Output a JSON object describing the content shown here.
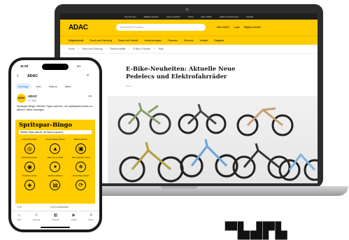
{
  "laptop": {
    "topbar": [
      "Top Themen",
      "Mitglied werden",
      "Auto & Verkehr",
      "Reise",
      "Mein ADAC",
      "ADAC Versicherung",
      "Kontakt"
    ],
    "logo": "ADAC",
    "search_placeholder": "Suchbegriff eingeben",
    "header_links": [
      "Mein ADAC",
      "Login",
      "Mitglied werden"
    ],
    "nav": [
      "Mitgliedschaft",
      "Rund ums Fahrzeug",
      "Reise und Freizeit",
      "Versicherungen",
      "Finanzen",
      "Services",
      "Vorteile",
      "Ratgeber"
    ],
    "breadcrumb": [
      "Home",
      "Rund ums Fahrzeug",
      "Elektromobilität",
      "E-Bike & Pedelec",
      "Tests"
    ],
    "article_title": "E-Bike-Neuheiten: Aktuelle Neue Pedelecs und Elektrofahrräder",
    "byline": "ADAC"
  },
  "phone": {
    "time": "11:02",
    "status": "5G",
    "page_title": "ADAC",
    "tabs": [
      "Beiträge",
      "Info",
      "Videos",
      "Mehr"
    ],
    "post_author": "ADAC",
    "post_meta": "21. Mai",
    "post_text": "Spritspar-Bingo: Welche Tipps nutzt ihr, um spritsparend Auto zu fahren? Mehr anzeigen",
    "bingo_title": "Spritspar-Bingo",
    "bingo_sub": "Welche Tipps nutzt ihr, um Sprit zu sparen?",
    "bingo_cells": [
      {
        "label": "Früh hochschalten",
        "icon": "◎"
      },
      {
        "label": "Vorausschauend fahren",
        "icon": "▲"
      },
      {
        "label": "Ballast entfernen",
        "icon": "▣"
      },
      {
        "label": "Reifendruck prüfen",
        "icon": "◉"
      },
      {
        "label": "Motor aus im Stand",
        "icon": "✦"
      },
      {
        "label": "Klima sparsam nutzen",
        "icon": "❄"
      },
      {
        "label": "Tempomat nutzen",
        "icon": "◈"
      },
      {
        "label": "Dachbox abbauen",
        "icon": "▤"
      },
      {
        "label": "Kurze Wege meiden",
        "icon": "⟳"
      }
    ],
    "reactions": "2,1K",
    "comments": "143 Kommentare",
    "bottom_nav": [
      {
        "label": "Start",
        "icon": "⌂"
      },
      {
        "label": "Freunde",
        "icon": "☺"
      },
      {
        "label": "Gruppen",
        "icon": "▦"
      },
      {
        "label": "Videos",
        "icon": "▶"
      },
      {
        "label": "Menü",
        "icon": "≡"
      }
    ]
  },
  "colors": {
    "brand": "#ffcc00",
    "dark": "#1f1f1f"
  }
}
